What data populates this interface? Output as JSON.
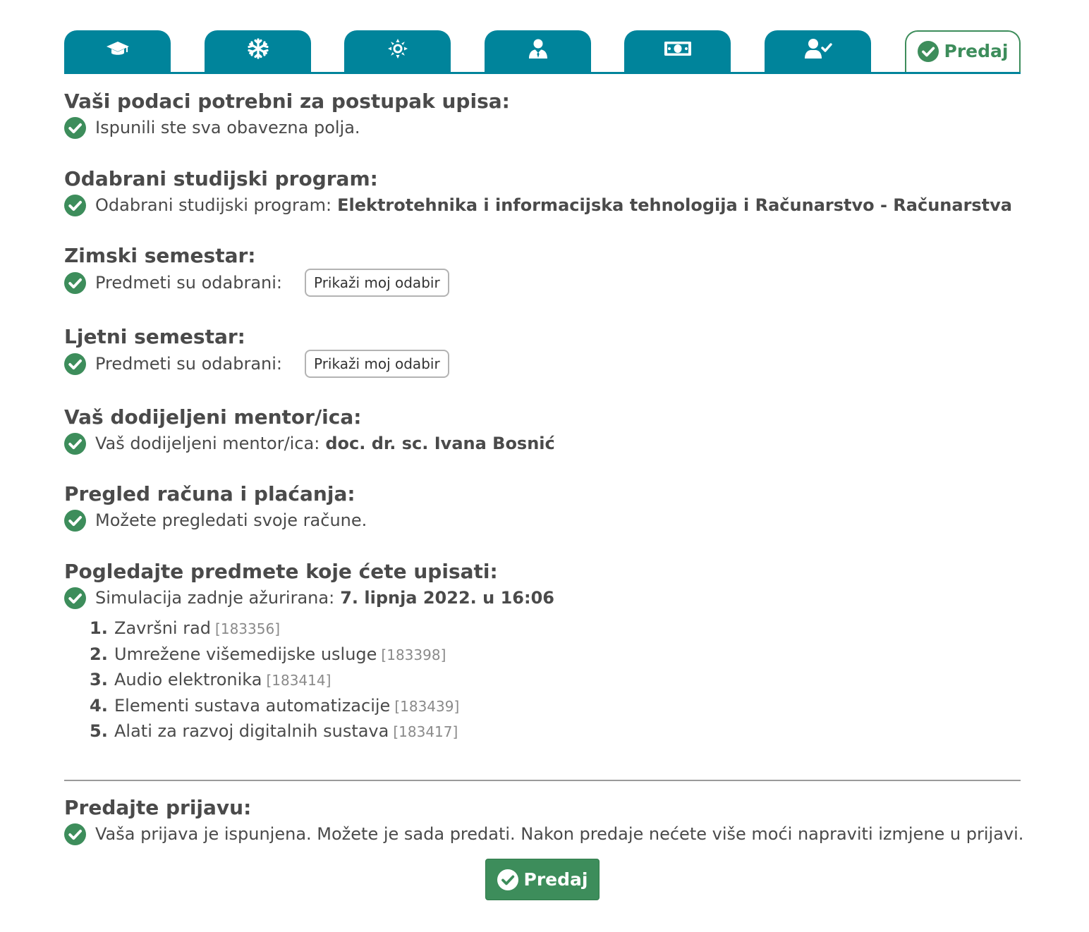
{
  "tabs": [
    {
      "icon": "graduation-cap-icon"
    },
    {
      "icon": "snowflake-icon"
    },
    {
      "icon": "sun-icon"
    },
    {
      "icon": "user-tie-icon"
    },
    {
      "icon": "money-bill-icon"
    },
    {
      "icon": "user-check-icon"
    }
  ],
  "active_tab": {
    "label": "Predaj",
    "icon": "check-circle-icon"
  },
  "colors": {
    "tab": "#00849b",
    "success": "#3d8d5b",
    "text": "#4a4a4a"
  },
  "sections": {
    "personal": {
      "heading": "Vaši podaci potrebni za postupak upisa:",
      "text": "Ispunili ste sva obavezna polja."
    },
    "program": {
      "heading": "Odabrani studijski program:",
      "text": "Odabrani studijski program:",
      "value": "Elektrotehnika i informacijska tehnologija i Računarstvo - Računarstva"
    },
    "winter": {
      "heading": "Zimski semestar:",
      "text": "Predmeti su odabrani:",
      "button": "Prikaži moj odabir"
    },
    "summer": {
      "heading": "Ljetni semestar:",
      "text": "Predmeti su odabrani:",
      "button": "Prikaži moj odabir"
    },
    "mentor": {
      "heading": "Vaš dodijeljeni mentor/ica:",
      "text": "Vaš dodijeljeni mentor/ica:",
      "value": "doc. dr. sc. Ivana Bosnić"
    },
    "billing": {
      "heading": "Pregled računa i plaćanja:",
      "text": "Možete pregledati svoje račune."
    },
    "courses": {
      "heading": "Pogledajte predmete koje ćete upisati:",
      "text": "Simulacija zadnje ažurirana:",
      "value": "7. lipnja 2022. u 16:06",
      "items": [
        {
          "num": "1.",
          "name": "Završni rad",
          "code": "[183356]"
        },
        {
          "num": "2.",
          "name": "Umrežene višemedijske usluge",
          "code": "[183398]"
        },
        {
          "num": "3.",
          "name": "Audio elektronika",
          "code": "[183414]"
        },
        {
          "num": "4.",
          "name": "Elementi sustava automatizacije",
          "code": "[183439]"
        },
        {
          "num": "5.",
          "name": "Alati za razvoj digitalnih sustava",
          "code": "[183417]"
        }
      ]
    },
    "submit": {
      "heading": "Predajte prijavu:",
      "text": "Vaša prijava je ispunjena. Možete je sada predati. Nakon predaje nećete više moći napraviti izmjene u prijavi.",
      "button": "Predaj"
    }
  }
}
